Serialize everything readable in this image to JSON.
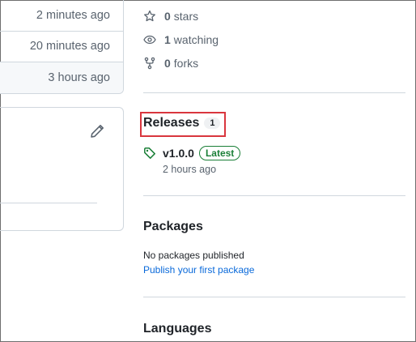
{
  "commit_times": [
    "2 minutes ago",
    "20 minutes ago",
    "3 hours ago"
  ],
  "about": {
    "stars_count": "0",
    "stars_label": "stars",
    "watching_count": "1",
    "watching_label": "watching",
    "forks_count": "0",
    "forks_label": "forks"
  },
  "releases": {
    "title": "Releases",
    "count": "1",
    "tag": "v1.0.0",
    "badge": "Latest",
    "time": "2 hours ago"
  },
  "packages": {
    "title": "Packages",
    "empty_text": "No packages published",
    "publish_link": "Publish your first package"
  },
  "languages": {
    "title": "Languages"
  },
  "icons": [
    "star-icon",
    "eye-icon",
    "repo-forked-icon",
    "pencil-icon",
    "tag-icon"
  ],
  "colors": {
    "link": "#0969da",
    "latest_green": "#1a7f37",
    "highlight_red": "#d9363e",
    "muted": "#59636e"
  }
}
